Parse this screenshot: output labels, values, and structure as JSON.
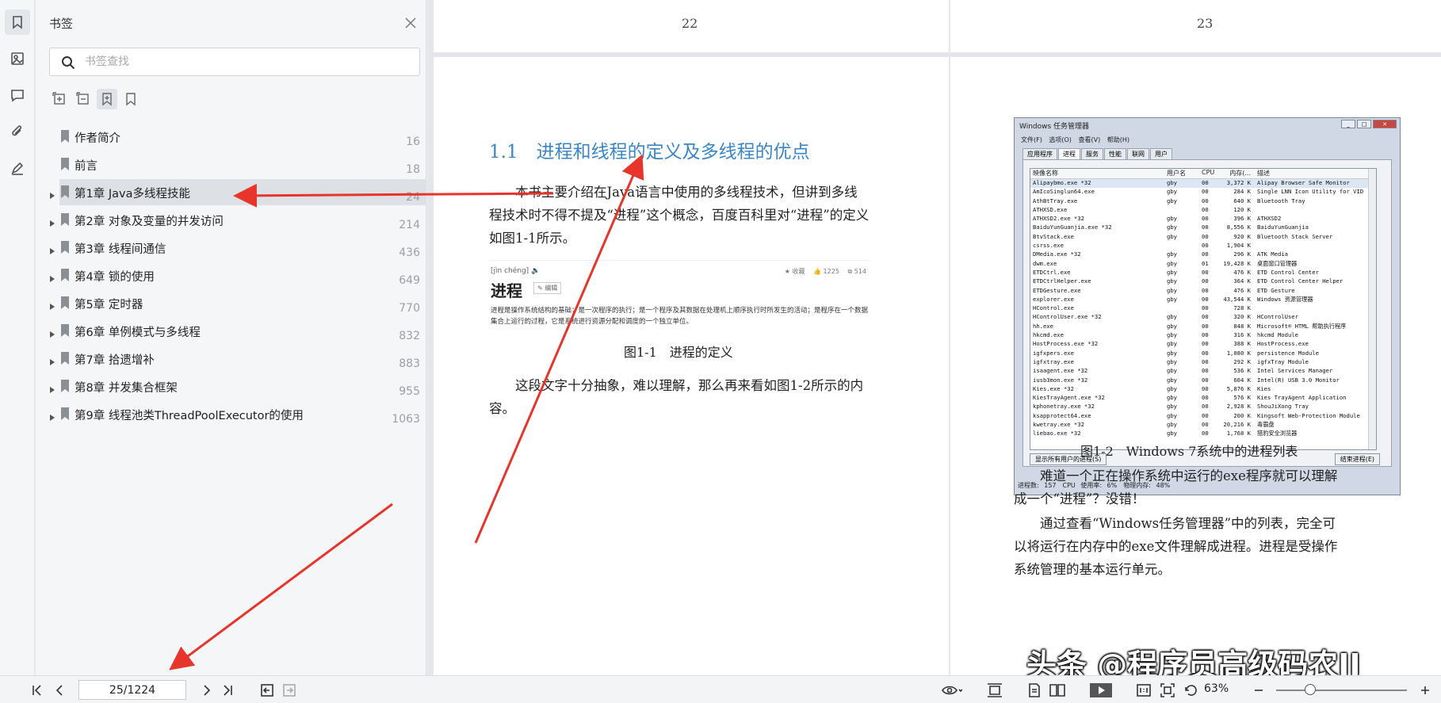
{
  "rail": {
    "icons": [
      "bookmark-icon",
      "thumbnail-icon",
      "comment-icon",
      "attachment-icon",
      "signature-icon"
    ]
  },
  "bookmarks_panel": {
    "title": "书签",
    "search_placeholder": "书签查找",
    "items": [
      {
        "label": "作者简介",
        "page": "16",
        "expandable": false
      },
      {
        "label": "前言",
        "page": "18",
        "expandable": false
      },
      {
        "label": "第1章 Java多线程技能",
        "page": "24",
        "expandable": true,
        "selected": true
      },
      {
        "label": "第2章 对象及变量的并发访问",
        "page": "214",
        "expandable": true
      },
      {
        "label": "第3章 线程间通信",
        "page": "436",
        "expandable": true
      },
      {
        "label": "第4章 锁的使用",
        "page": "649",
        "expandable": true
      },
      {
        "label": "第5章 定时器",
        "page": "770",
        "expandable": true
      },
      {
        "label": "第6章 单例模式与多线程",
        "page": "832",
        "expandable": true
      },
      {
        "label": "第7章 拾遗增补",
        "page": "883",
        "expandable": true
      },
      {
        "label": "第8章 并发集合框架",
        "page": "955",
        "expandable": true
      },
      {
        "label": "第9章 线程池类ThreadPoolExecutor的使用",
        "page": "1063",
        "expandable": true
      }
    ]
  },
  "document": {
    "left_page_number": "22",
    "right_page_number": "23",
    "heading": "1.1　进程和线程的定义及多线程的优点",
    "para1": "本书主要介绍在Java语言中使用的多线程技术，但讲到多线程技术时不得不提及“进程”这个概念，百度百科里对“进程”的定义如图1-1所示。",
    "baike": {
      "pinyin": "[jìn chéng] 🔈",
      "word": "进程",
      "edit": "✎ 编辑",
      "stats": "★ 收藏　 👍 1225　 ⧉ 514",
      "definition": "进程是操作系统结构的基础；是一次程序的执行；是一个程序及其数据在处理机上顺序执行时所发生的活动；是程序在一个数据集合上运行的过程，它是系统进行资源分配和调度的一个独立单位。"
    },
    "caption1": "图1-1　进程的定义",
    "para2": "这段文字十分抽象，难以理解，那么再来看如图1-2所示的内容。",
    "caption2": "图1-2　Windows 7系统中的进程列表",
    "para3": "难道一个正在操作系统中运行的exe程序就可以理解成一个“进程”？没错！",
    "para4": "通过查看“Windows任务管理器”中的列表，完全可以将运行在内存中的exe文件理解成进程。进程是受操作系统管理的基本运行单元。"
  },
  "task_manager": {
    "title": "Windows 任务管理器",
    "menu": [
      "文件(F)",
      "选项(O)",
      "查看(V)",
      "帮助(H)"
    ],
    "tabs": [
      "应用程序",
      "进程",
      "服务",
      "性能",
      "联网",
      "用户"
    ],
    "active_tab": "进程",
    "columns": [
      "映像名称",
      "用户名",
      "CPU",
      "内存(...",
      "描述"
    ],
    "rows": [
      [
        "Alipaybmo.exe *32",
        "gby",
        "00",
        "3,372 K",
        "Alipay Browser Safe Monitor"
      ],
      [
        "AmIcoSinglun64.exe",
        "gby",
        "00",
        "284 K",
        "Single LNN Icon Utility for VID"
      ],
      [
        "AthBtTray.exe",
        "gby",
        "00",
        "640 K",
        "Bluetooth Tray"
      ],
      [
        "ATHXSD.exe",
        "",
        "00",
        "120 K",
        ""
      ],
      [
        "ATHXSD2.exe *32",
        "gby",
        "00",
        "396 K",
        "ATHXSD2"
      ],
      [
        "BaiduYunGuanjia.exe *32",
        "gby",
        "00",
        "8,556 K",
        "BaiduYunGuanjia"
      ],
      [
        "BtvStack.exe",
        "gby",
        "00",
        "920 K",
        "Bluetooth Stack Server"
      ],
      [
        "csrss.exe",
        "",
        "00",
        "1,904 K",
        ""
      ],
      [
        "DMedia.exe *32",
        "gby",
        "00",
        "296 K",
        "ATK Media"
      ],
      [
        "dwm.exe",
        "gby",
        "01",
        "19,428 K",
        "桌面窗口管理器"
      ],
      [
        "ETDCtrl.exe",
        "gby",
        "00",
        "476 K",
        "ETD Control Center"
      ],
      [
        "ETDCtrlHelper.exe",
        "gby",
        "00",
        "364 K",
        "ETD Control Center Helper"
      ],
      [
        "ETDGesture.exe",
        "gby",
        "00",
        "476 K",
        "ETD Gesture"
      ],
      [
        "explorer.exe",
        "gby",
        "00",
        "43,544 K",
        "Windows 资源管理器"
      ],
      [
        "HControl.exe",
        "",
        "00",
        "728 K",
        ""
      ],
      [
        "HControlUser.exe *32",
        "gby",
        "00",
        "320 K",
        "HControlUser"
      ],
      [
        "hh.exe",
        "gby",
        "00",
        "848 K",
        "Microsoft® HTML 帮助执行程序"
      ],
      [
        "hkcmd.exe",
        "gby",
        "00",
        "316 K",
        "hkcmd Module"
      ],
      [
        "HostProcess.exe *32",
        "gby",
        "00",
        "388 K",
        "HostProcess.exe"
      ],
      [
        "igfxpers.exe",
        "gby",
        "00",
        "1,080 K",
        "persistence Module"
      ],
      [
        "igfxtray.exe",
        "gby",
        "00",
        "292 K",
        "igfxTray Module"
      ],
      [
        "isaagent.exe *32",
        "gby",
        "00",
        "536 K",
        "Intel Services Manager"
      ],
      [
        "iusb3mon.exe *32",
        "gby",
        "00",
        "604 K",
        "Intel(R) USB 3.0 Monitor"
      ],
      [
        "Kies.exe *32",
        "gby",
        "00",
        "5,876 K",
        "Kies"
      ],
      [
        "KiesTrayAgent.exe *32",
        "gby",
        "00",
        "576 K",
        "Kies TrayAgent Application"
      ],
      [
        "kphonetray.exe *32",
        "gby",
        "00",
        "2,928 K",
        "ShouJiXong Tray"
      ],
      [
        "ksapprotect64.exe",
        "gby",
        "00",
        "200 K",
        "Kingsoft Web-Protection Module"
      ],
      [
        "kwetray.exe *32",
        "gby",
        "00",
        "20,216 K",
        "毒霸盘"
      ],
      [
        "liebao.exe *32",
        "gby",
        "00",
        "1,768 K",
        "猎豹安全浏览器"
      ]
    ],
    "show_all_button": "显示所有用户的进程(S)",
    "end_process_button": "结束进程(E)",
    "status": "进程数: 157　CPU 使用率: 6%　物理内存: 48%"
  },
  "watermark": "头条 @程序员高级码农II",
  "bottom_bar": {
    "page_value": "25/1224",
    "zoom": "63%",
    "zoom_fraction": 0.26
  }
}
